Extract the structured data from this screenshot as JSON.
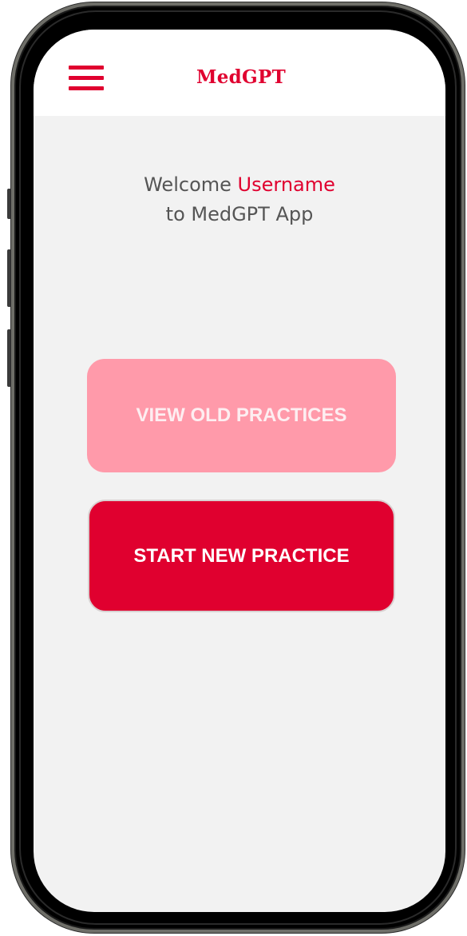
{
  "header": {
    "title": "MedGPT",
    "menu_icon": "hamburger-menu-icon"
  },
  "welcome": {
    "prefix": "Welcome ",
    "username": "Username",
    "line2": "to MedGPT App"
  },
  "actions": {
    "view_old_label": "VIEW OLD PRACTICES",
    "start_new_label": "START NEW PRACTICE"
  },
  "colors": {
    "accent": "#e0002f",
    "accent_light": "#ff9aaa",
    "background": "#f2f2f2",
    "text": "#555555"
  }
}
